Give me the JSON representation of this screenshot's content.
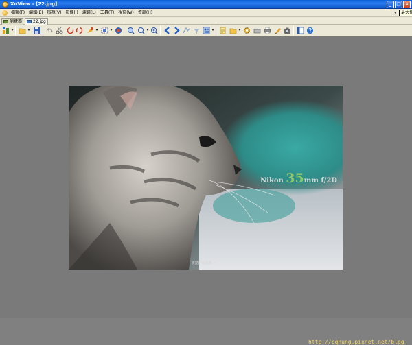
{
  "window": {
    "title": "XnView - [22.jpg]",
    "colors": {
      "titlebar": "#0b56c8",
      "chrome": "#ece9d8",
      "viewer_bg": "#7a7a7a"
    }
  },
  "titlebar_buttons": {
    "minimize": "_",
    "maximize": "□",
    "close": "×"
  },
  "menubar": {
    "items": [
      "檔案(F)",
      "編輯(E)",
      "檢視(V)",
      "影像(I)",
      "濾鏡(L)",
      "工具(T)",
      "視窗(W)",
      "資訊(H)"
    ],
    "right_glyph": "▾"
  },
  "tooltip": "最大化",
  "tabs": [
    {
      "label": "瀏覽器",
      "icon": "browser-icon"
    },
    {
      "label": "22.jpg",
      "icon": "image-file-icon",
      "active": true
    }
  ],
  "toolbar": {
    "icons": [
      "browser-icon",
      "open-folder-icon",
      "save-icon",
      "undo-icon",
      "cut-icon",
      "rotate-left-icon",
      "rotate-right-icon",
      "effects-icon",
      "select-icon",
      "color-icon",
      "zoom-fit-icon",
      "zoom-out-icon",
      "zoom-in-icon",
      "previous-icon",
      "next-icon",
      "adjust-icon",
      "filter-icon",
      "view-mode-icon",
      "page-icon",
      "folder-icon",
      "settings-icon",
      "scanner-icon",
      "print-icon",
      "sign-icon",
      "camera-icon",
      "panel-icon",
      "help-icon"
    ]
  },
  "photo": {
    "overlay_prefix": "Nikon ",
    "overlay_big": "35",
    "overlay_suffix": "mm f/2D",
    "caption": "— 被愛的就是貓 —"
  },
  "watermark": "http://cqhung.pixnet.net/blog"
}
